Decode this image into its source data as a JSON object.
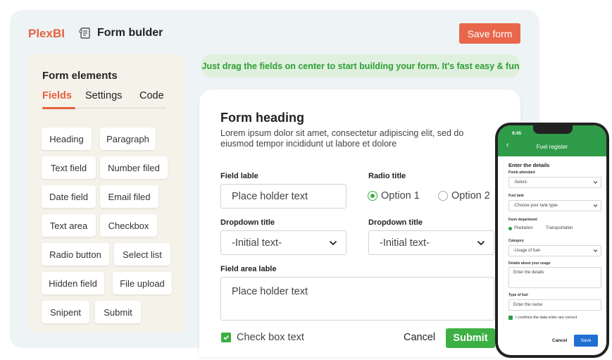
{
  "app": {
    "brand": "PlexBI",
    "page_title": "Form bulder",
    "save_form_label": "Save form"
  },
  "sidebar": {
    "title": "Form elements",
    "tabs": [
      "Fields",
      "Settings",
      "Code"
    ],
    "active_tab": "Fields",
    "fields": [
      "Heading",
      "Paragraph",
      "Text field",
      "Number filed",
      "Date field",
      "Email filed",
      "Text area",
      "Checkbox",
      "Radio button",
      "Select list",
      "Hidden field",
      "File upload",
      "Snipent",
      "Submit"
    ]
  },
  "banner": "Just drag the fields on center to start building your form. It's fast easy & fun",
  "form": {
    "heading": "Form heading",
    "description": "Lorem ipsum dolor sit amet, consectetur adipiscing elit, sed do eiusmod tempor incididunt ut labore et dolore",
    "field_label": "Field lable",
    "field_placeholder": "Place holder text",
    "radio_title": "Radio title",
    "radio_options": [
      "Option 1",
      "Option 2"
    ],
    "radio_selected": "Option 1",
    "dropdown1_title": "Dropdown title",
    "dropdown1_value": "-Initial text-",
    "dropdown2_title": "Dropdown title",
    "dropdown2_value": "-Initial text-",
    "area_label": "Field area lable",
    "area_placeholder": "Place holder text",
    "checkbox_label": "Check box text",
    "checkbox_checked": true,
    "cancel_label": "Cancel",
    "submit_label": "Submit"
  },
  "phone": {
    "time": "9:45",
    "title": "Fuel register",
    "section": "Enter the details",
    "pump_label": "Pumb attendant",
    "pump_value": "-Select-",
    "tank_label": "Fuel tank",
    "tank_value": "-Choose your tank type-",
    "dept_label": "Farm department",
    "dept_options": [
      "Plantation",
      "Transportation"
    ],
    "dept_selected": "Plantation",
    "category_label": "Category",
    "category_value": "-Usage of fuel-",
    "details_label": "Details about your usage",
    "details_placeholder": "Enter the details",
    "type_label": "Type of fuel",
    "type_placeholder": "Enter the name",
    "confirm_label": "I confirms the data enter are correct",
    "cancel_label": "Cancel",
    "save_label": "Save"
  },
  "colors": {
    "brand": "#e8613f",
    "save_button": "#e8674b",
    "green": "#3cb043",
    "phone_header": "#2e9c49",
    "phone_save": "#1f6fd1"
  }
}
